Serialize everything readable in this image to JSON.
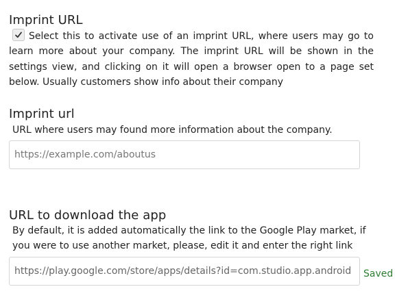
{
  "imprint": {
    "title": "Imprint URL",
    "checkbox_checked": true,
    "description": "Select this to activate use of an imprint URL, where users may go to learn more about your company. The imprint URL will be shown in the settings view, and clicking on it will open a browser open to a page set below. Usually customers show info about their company"
  },
  "imprint_url": {
    "title": "Imprint url",
    "description": "URL where users may found more information about the company.",
    "placeholder": "https://example.com/aboutus",
    "value": ""
  },
  "download_url": {
    "title": "URL to download the app",
    "description": "By default, it is added automatically the link to the Google Play market, if you were to use another market, please, edit it and enter the right link",
    "value": "https://play.google.com/store/apps/details?id=com.studio.app.android",
    "status": "Saved",
    "status_color": "#2e7d32"
  }
}
